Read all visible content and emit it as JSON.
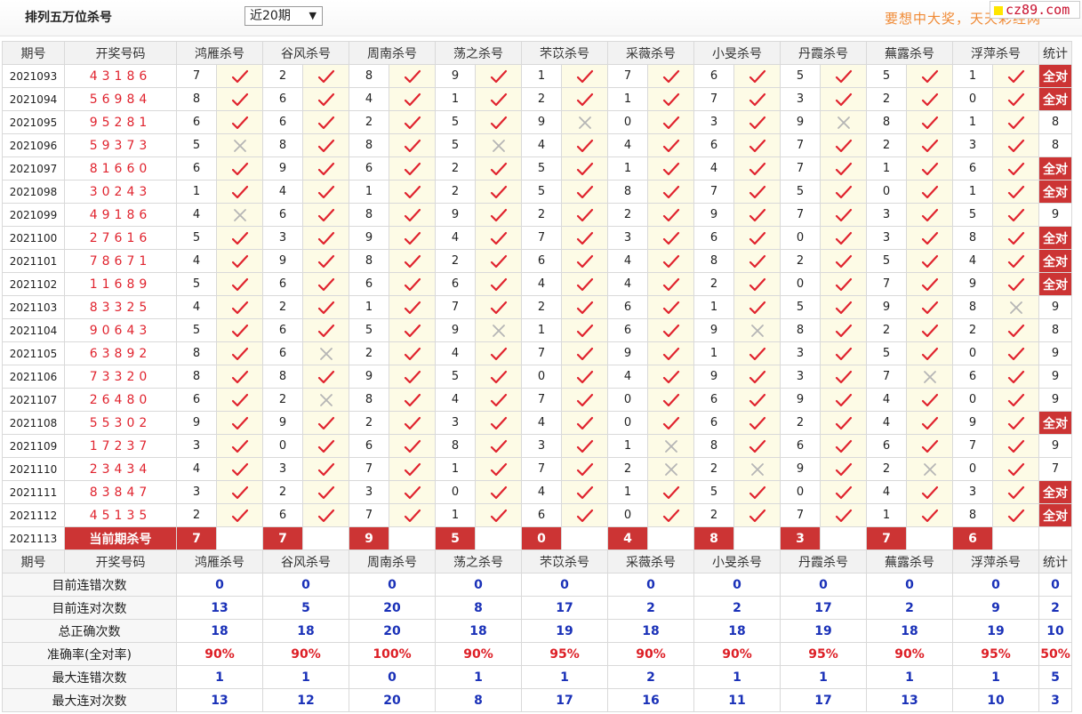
{
  "header": {
    "title": "排列五万位杀号",
    "period_select": "近20期",
    "slogan": "要想中大奖，天天彩经网",
    "site_badge": "cz89.com"
  },
  "colors": {
    "accent_red": "#cc3434",
    "check_red": "#e0232e",
    "cross_gray": "#b5b5b5",
    "value_blue": "#1a31b8"
  },
  "columns": [
    "期号",
    "开奖号码",
    "鸿雁杀号",
    "谷风杀号",
    "周南杀号",
    "荡之杀号",
    "芣苡杀号",
    "采薇杀号",
    "小旻杀号",
    "丹霞杀号",
    "蕪露杀号",
    "浮萍杀号",
    "统计"
  ],
  "rows": [
    {
      "issue": "2021093",
      "draw": "43186",
      "kills": [
        [
          "7",
          1
        ],
        [
          "2",
          1
        ],
        [
          "8",
          1
        ],
        [
          "9",
          1
        ],
        [
          "1",
          1
        ],
        [
          "7",
          1
        ],
        [
          "6",
          1
        ],
        [
          "5",
          1
        ],
        [
          "5",
          1
        ],
        [
          "1",
          1
        ]
      ],
      "stat": "全对"
    },
    {
      "issue": "2021094",
      "draw": "56984",
      "kills": [
        [
          "8",
          1
        ],
        [
          "6",
          1
        ],
        [
          "4",
          1
        ],
        [
          "1",
          1
        ],
        [
          "2",
          1
        ],
        [
          "1",
          1
        ],
        [
          "7",
          1
        ],
        [
          "3",
          1
        ],
        [
          "2",
          1
        ],
        [
          "0",
          1
        ]
      ],
      "stat": "全对"
    },
    {
      "issue": "2021095",
      "draw": "95281",
      "kills": [
        [
          "6",
          1
        ],
        [
          "6",
          1
        ],
        [
          "2",
          1
        ],
        [
          "5",
          1
        ],
        [
          "9",
          0
        ],
        [
          "0",
          1
        ],
        [
          "3",
          1
        ],
        [
          "9",
          0
        ],
        [
          "8",
          1
        ],
        [
          "1",
          1
        ]
      ],
      "stat": "8"
    },
    {
      "issue": "2021096",
      "draw": "59373",
      "kills": [
        [
          "5",
          0
        ],
        [
          "8",
          1
        ],
        [
          "8",
          1
        ],
        [
          "5",
          0
        ],
        [
          "4",
          1
        ],
        [
          "4",
          1
        ],
        [
          "6",
          1
        ],
        [
          "7",
          1
        ],
        [
          "2",
          1
        ],
        [
          "3",
          1
        ]
      ],
      "stat": "8"
    },
    {
      "issue": "2021097",
      "draw": "81660",
      "kills": [
        [
          "6",
          1
        ],
        [
          "9",
          1
        ],
        [
          "6",
          1
        ],
        [
          "2",
          1
        ],
        [
          "5",
          1
        ],
        [
          "1",
          1
        ],
        [
          "4",
          1
        ],
        [
          "7",
          1
        ],
        [
          "1",
          1
        ],
        [
          "6",
          1
        ]
      ],
      "stat": "全对"
    },
    {
      "issue": "2021098",
      "draw": "30243",
      "kills": [
        [
          "1",
          1
        ],
        [
          "4",
          1
        ],
        [
          "1",
          1
        ],
        [
          "2",
          1
        ],
        [
          "5",
          1
        ],
        [
          "8",
          1
        ],
        [
          "7",
          1
        ],
        [
          "5",
          1
        ],
        [
          "0",
          1
        ],
        [
          "1",
          1
        ]
      ],
      "stat": "全对"
    },
    {
      "issue": "2021099",
      "draw": "49186",
      "kills": [
        [
          "4",
          0
        ],
        [
          "6",
          1
        ],
        [
          "8",
          1
        ],
        [
          "9",
          1
        ],
        [
          "2",
          1
        ],
        [
          "2",
          1
        ],
        [
          "9",
          1
        ],
        [
          "7",
          1
        ],
        [
          "3",
          1
        ],
        [
          "5",
          1
        ]
      ],
      "stat": "9"
    },
    {
      "issue": "2021100",
      "draw": "27616",
      "kills": [
        [
          "5",
          1
        ],
        [
          "3",
          1
        ],
        [
          "9",
          1
        ],
        [
          "4",
          1
        ],
        [
          "7",
          1
        ],
        [
          "3",
          1
        ],
        [
          "6",
          1
        ],
        [
          "0",
          1
        ],
        [
          "3",
          1
        ],
        [
          "8",
          1
        ]
      ],
      "stat": "全对"
    },
    {
      "issue": "2021101",
      "draw": "78671",
      "kills": [
        [
          "4",
          1
        ],
        [
          "9",
          1
        ],
        [
          "8",
          1
        ],
        [
          "2",
          1
        ],
        [
          "6",
          1
        ],
        [
          "4",
          1
        ],
        [
          "8",
          1
        ],
        [
          "2",
          1
        ],
        [
          "5",
          1
        ],
        [
          "4",
          1
        ]
      ],
      "stat": "全对"
    },
    {
      "issue": "2021102",
      "draw": "11689",
      "kills": [
        [
          "5",
          1
        ],
        [
          "6",
          1
        ],
        [
          "6",
          1
        ],
        [
          "6",
          1
        ],
        [
          "4",
          1
        ],
        [
          "4",
          1
        ],
        [
          "2",
          1
        ],
        [
          "0",
          1
        ],
        [
          "7",
          1
        ],
        [
          "9",
          1
        ]
      ],
      "stat": "全对"
    },
    {
      "issue": "2021103",
      "draw": "83325",
      "kills": [
        [
          "4",
          1
        ],
        [
          "2",
          1
        ],
        [
          "1",
          1
        ],
        [
          "7",
          1
        ],
        [
          "2",
          1
        ],
        [
          "6",
          1
        ],
        [
          "1",
          1
        ],
        [
          "5",
          1
        ],
        [
          "9",
          1
        ],
        [
          "8",
          0
        ]
      ],
      "stat": "9"
    },
    {
      "issue": "2021104",
      "draw": "90643",
      "kills": [
        [
          "5",
          1
        ],
        [
          "6",
          1
        ],
        [
          "5",
          1
        ],
        [
          "9",
          0
        ],
        [
          "1",
          1
        ],
        [
          "6",
          1
        ],
        [
          "9",
          0
        ],
        [
          "8",
          1
        ],
        [
          "2",
          1
        ],
        [
          "2",
          1
        ]
      ],
      "stat": "8"
    },
    {
      "issue": "2021105",
      "draw": "63892",
      "kills": [
        [
          "8",
          1
        ],
        [
          "6",
          0
        ],
        [
          "2",
          1
        ],
        [
          "4",
          1
        ],
        [
          "7",
          1
        ],
        [
          "9",
          1
        ],
        [
          "1",
          1
        ],
        [
          "3",
          1
        ],
        [
          "5",
          1
        ],
        [
          "0",
          1
        ]
      ],
      "stat": "9"
    },
    {
      "issue": "2021106",
      "draw": "73320",
      "kills": [
        [
          "8",
          1
        ],
        [
          "8",
          1
        ],
        [
          "9",
          1
        ],
        [
          "5",
          1
        ],
        [
          "0",
          1
        ],
        [
          "4",
          1
        ],
        [
          "9",
          1
        ],
        [
          "3",
          1
        ],
        [
          "7",
          0
        ],
        [
          "6",
          1
        ]
      ],
      "stat": "9"
    },
    {
      "issue": "2021107",
      "draw": "26480",
      "kills": [
        [
          "6",
          1
        ],
        [
          "2",
          0
        ],
        [
          "8",
          1
        ],
        [
          "4",
          1
        ],
        [
          "7",
          1
        ],
        [
          "0",
          1
        ],
        [
          "6",
          1
        ],
        [
          "9",
          1
        ],
        [
          "4",
          1
        ],
        [
          "0",
          1
        ]
      ],
      "stat": "9"
    },
    {
      "issue": "2021108",
      "draw": "55302",
      "kills": [
        [
          "9",
          1
        ],
        [
          "9",
          1
        ],
        [
          "2",
          1
        ],
        [
          "3",
          1
        ],
        [
          "4",
          1
        ],
        [
          "0",
          1
        ],
        [
          "6",
          1
        ],
        [
          "2",
          1
        ],
        [
          "4",
          1
        ],
        [
          "9",
          1
        ]
      ],
      "stat": "全对"
    },
    {
      "issue": "2021109",
      "draw": "17237",
      "kills": [
        [
          "3",
          1
        ],
        [
          "0",
          1
        ],
        [
          "6",
          1
        ],
        [
          "8",
          1
        ],
        [
          "3",
          1
        ],
        [
          "1",
          0
        ],
        [
          "8",
          1
        ],
        [
          "6",
          1
        ],
        [
          "6",
          1
        ],
        [
          "7",
          1
        ]
      ],
      "stat": "9"
    },
    {
      "issue": "2021110",
      "draw": "23434",
      "kills": [
        [
          "4",
          1
        ],
        [
          "3",
          1
        ],
        [
          "7",
          1
        ],
        [
          "1",
          1
        ],
        [
          "7",
          1
        ],
        [
          "2",
          0
        ],
        [
          "2",
          0
        ],
        [
          "9",
          1
        ],
        [
          "2",
          0
        ],
        [
          "0",
          1
        ]
      ],
      "stat": "7"
    },
    {
      "issue": "2021111",
      "draw": "83847",
      "kills": [
        [
          "3",
          1
        ],
        [
          "2",
          1
        ],
        [
          "3",
          1
        ],
        [
          "0",
          1
        ],
        [
          "4",
          1
        ],
        [
          "1",
          1
        ],
        [
          "5",
          1
        ],
        [
          "0",
          1
        ],
        [
          "4",
          1
        ],
        [
          "3",
          1
        ]
      ],
      "stat": "全对"
    },
    {
      "issue": "2021112",
      "draw": "45135",
      "kills": [
        [
          "2",
          1
        ],
        [
          "6",
          1
        ],
        [
          "7",
          1
        ],
        [
          "1",
          1
        ],
        [
          "6",
          1
        ],
        [
          "0",
          1
        ],
        [
          "2",
          1
        ],
        [
          "7",
          1
        ],
        [
          "1",
          1
        ],
        [
          "8",
          1
        ]
      ],
      "stat": "全对"
    }
  ],
  "current": {
    "issue": "2021113",
    "label": "当前期杀号",
    "kills": [
      "7",
      "7",
      "9",
      "5",
      "0",
      "4",
      "8",
      "3",
      "7",
      "6"
    ]
  },
  "summary": [
    {
      "label": "目前连错次数",
      "values": [
        "0",
        "0",
        "0",
        "0",
        "0",
        "0",
        "0",
        "0",
        "0",
        "0",
        "0"
      ],
      "color": "blue"
    },
    {
      "label": "目前连对次数",
      "values": [
        "13",
        "5",
        "20",
        "8",
        "17",
        "2",
        "2",
        "17",
        "2",
        "9",
        "2"
      ],
      "color": "blue"
    },
    {
      "label": "总正确次数",
      "values": [
        "18",
        "18",
        "20",
        "18",
        "19",
        "18",
        "18",
        "19",
        "18",
        "19",
        "10"
      ],
      "color": "blue"
    },
    {
      "label": "准确率(全对率)",
      "values": [
        "90%",
        "90%",
        "100%",
        "90%",
        "95%",
        "90%",
        "90%",
        "95%",
        "90%",
        "95%",
        "50%"
      ],
      "color": "red"
    },
    {
      "label": "最大连错次数",
      "values": [
        "1",
        "1",
        "0",
        "1",
        "1",
        "2",
        "1",
        "1",
        "1",
        "1",
        "5"
      ],
      "color": "blue"
    },
    {
      "label": "最大连对次数",
      "values": [
        "13",
        "12",
        "20",
        "8",
        "17",
        "16",
        "11",
        "17",
        "13",
        "10",
        "3"
      ],
      "color": "blue"
    }
  ]
}
